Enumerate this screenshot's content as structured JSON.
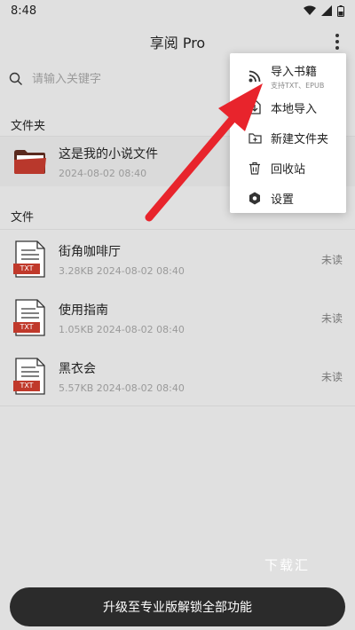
{
  "status_bar": {
    "time": "8:48"
  },
  "header": {
    "title": "享阅 Pro"
  },
  "search": {
    "placeholder": "请输入关键字"
  },
  "sections": {
    "folders": "文件夹",
    "files": "文件"
  },
  "folder": {
    "name": "这是我的小说文件",
    "date": "2024-08-02 08:40"
  },
  "files": [
    {
      "name": "街角咖啡厅",
      "meta": "3.28KB 2024-08-02 08:40",
      "status": "未读",
      "badge": "TXT"
    },
    {
      "name": "使用指南",
      "meta": "1.05KB 2024-08-02 08:40",
      "status": "未读",
      "badge": "TXT"
    },
    {
      "name": "黑衣会",
      "meta": "5.57KB 2024-08-02 08:40",
      "status": "未读",
      "badge": "TXT"
    }
  ],
  "menu": {
    "items": [
      {
        "label": "导入书籍",
        "sub": "支持TXT、EPUB",
        "icon": "rss-icon"
      },
      {
        "label": "本地导入",
        "icon": "file-import-icon"
      },
      {
        "label": "新建文件夹",
        "icon": "folder-plus-icon"
      },
      {
        "label": "回收站",
        "icon": "trash-icon"
      },
      {
        "label": "设置",
        "icon": "settings-icon"
      }
    ]
  },
  "watermark": "下载汇",
  "upgrade_button": {
    "label": "升级至专业版解锁全部功能"
  },
  "colors": {
    "accent_red": "#e8242c",
    "file_badge": "#c0392b",
    "upgrade_bg": "#2b2b2b"
  }
}
